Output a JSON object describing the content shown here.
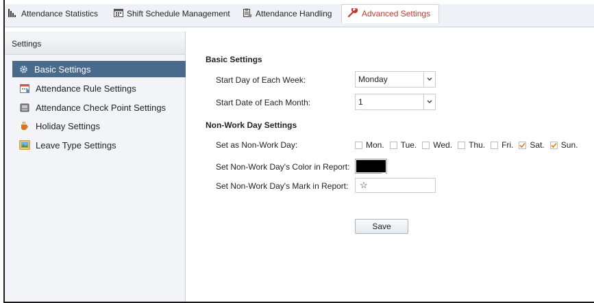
{
  "tabs": [
    {
      "label": "Attendance Statistics",
      "icon": "bar-chart-icon"
    },
    {
      "label": "Shift Schedule Management",
      "icon": "calendar-icon"
    },
    {
      "label": "Attendance Handling",
      "icon": "clipboard-icon"
    },
    {
      "label": "Advanced Settings",
      "icon": "wrench-icon",
      "active": true
    }
  ],
  "sidebar": {
    "header": "Settings",
    "items": [
      {
        "label": "Basic Settings",
        "icon": "gear-icon",
        "active": true
      },
      {
        "label": "Attendance Rule Settings",
        "icon": "calendar-rule-icon"
      },
      {
        "label": "Attendance Check Point Settings",
        "icon": "device-icon"
      },
      {
        "label": "Holiday Settings",
        "icon": "coffee-icon"
      },
      {
        "label": "Leave Type Settings",
        "icon": "picture-icon"
      }
    ]
  },
  "basic": {
    "title": "Basic Settings",
    "start_day_label": "Start Day of Each Week:",
    "start_day_value": "Monday",
    "start_date_label": "Start Date of Each Month:",
    "start_date_value": "1"
  },
  "nonwork": {
    "title": "Non-Work Day Settings",
    "set_label": "Set as Non-Work Day:",
    "days": [
      {
        "label": "Mon.",
        "checked": false
      },
      {
        "label": "Tue.",
        "checked": false
      },
      {
        "label": "Wed.",
        "checked": false
      },
      {
        "label": "Thu.",
        "checked": false
      },
      {
        "label": "Fri.",
        "checked": false
      },
      {
        "label": "Sat.",
        "checked": true
      },
      {
        "label": "Sun.",
        "checked": true
      }
    ],
    "color_label": "Set Non-Work Day's Color in Report:",
    "color_value": "#000000",
    "mark_label": "Set Non-Work Day's Mark in Report:",
    "mark_value": "☆"
  },
  "actions": {
    "save_label": "Save"
  },
  "colors": {
    "accent": "#4a6a8c",
    "active_tab_text": "#c0392b",
    "check": "#e07b00"
  }
}
